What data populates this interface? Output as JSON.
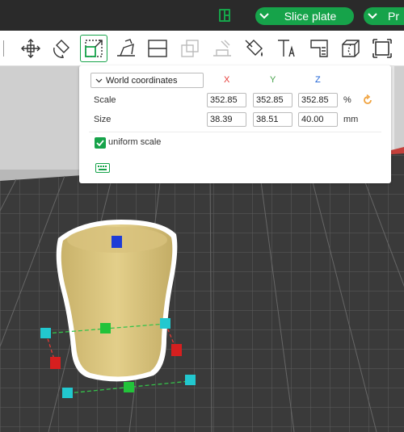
{
  "topbar": {
    "slice_label": "Slice plate",
    "print_label": "Pr",
    "accent": "#16a34a"
  },
  "toolbar": {
    "tools": [
      "move-icon",
      "rotate-icon",
      "scale-icon",
      "lay-on-face-icon",
      "split-icon",
      "assembly-icon",
      "support-painting-icon",
      "color-painting-icon",
      "text-icon",
      "measure-icon",
      "cut-icon",
      "fit-view-icon"
    ],
    "active_tool": "scale-icon"
  },
  "scale_panel": {
    "coordinate_system": "World coordinates",
    "axes": {
      "x": "X",
      "y": "Y",
      "z": "Z"
    },
    "axis_colors": {
      "x": "#e53935",
      "y": "#43a047",
      "z": "#1e63d6"
    },
    "scale": {
      "label": "Scale",
      "x": "352.85",
      "y": "352.85",
      "z": "352.85",
      "unit": "%"
    },
    "size": {
      "label": "Size",
      "x": "38.39",
      "y": "38.51",
      "z": "40.00",
      "unit": "mm"
    },
    "uniform_scale": {
      "label": "uniform scale",
      "checked": true
    }
  }
}
